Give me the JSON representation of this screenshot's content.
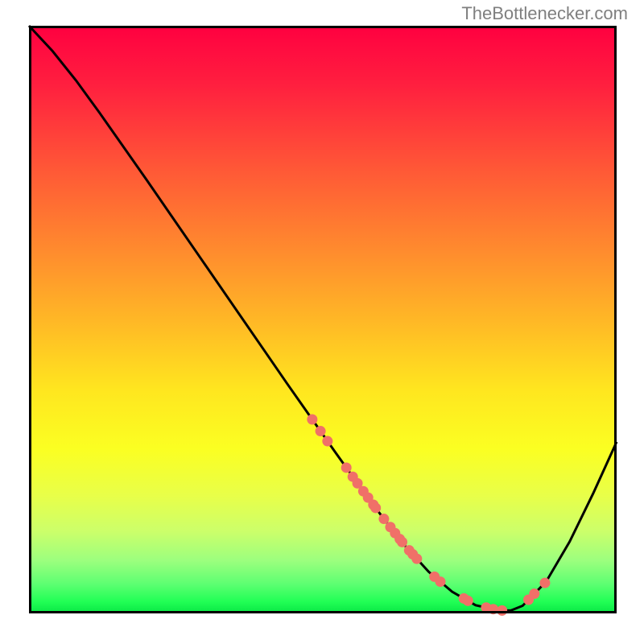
{
  "watermark": "TheBottlenecker.com",
  "chart_data": {
    "type": "line",
    "title": "",
    "xlabel": "",
    "ylabel": "",
    "xlim": [
      0,
      100
    ],
    "ylim": [
      0,
      100
    ],
    "curve": [
      {
        "x": 0.0,
        "y": 100.0
      },
      {
        "x": 4.0,
        "y": 95.7
      },
      {
        "x": 8.0,
        "y": 90.7
      },
      {
        "x": 12.0,
        "y": 85.2
      },
      {
        "x": 16.0,
        "y": 79.5
      },
      {
        "x": 20.0,
        "y": 73.8
      },
      {
        "x": 24.0,
        "y": 68.0
      },
      {
        "x": 28.0,
        "y": 62.2
      },
      {
        "x": 32.0,
        "y": 56.4
      },
      {
        "x": 36.0,
        "y": 50.6
      },
      {
        "x": 40.0,
        "y": 44.8
      },
      {
        "x": 44.0,
        "y": 39.0
      },
      {
        "x": 48.0,
        "y": 33.3
      },
      {
        "x": 52.0,
        "y": 27.6
      },
      {
        "x": 56.0,
        "y": 22.0
      },
      {
        "x": 60.0,
        "y": 16.6
      },
      {
        "x": 64.0,
        "y": 11.5
      },
      {
        "x": 68.0,
        "y": 7.1
      },
      {
        "x": 72.0,
        "y": 3.7
      },
      {
        "x": 76.0,
        "y": 1.4
      },
      {
        "x": 80.0,
        "y": 0.5
      },
      {
        "x": 82.0,
        "y": 0.5
      },
      {
        "x": 84.0,
        "y": 1.3
      },
      {
        "x": 88.0,
        "y": 5.4
      },
      {
        "x": 92.0,
        "y": 12.2
      },
      {
        "x": 96.0,
        "y": 20.4
      },
      {
        "x": 100.0,
        "y": 29.2
      }
    ],
    "points_on_curve_x": [
      48.2,
      49.6,
      50.8,
      54.0,
      55.1,
      55.9,
      56.9,
      57.7,
      58.6,
      59.0,
      60.4,
      61.5,
      62.3,
      63.1,
      63.5,
      64.7,
      65.3,
      66.0,
      69.0,
      70.0,
      74.0,
      74.7,
      77.8,
      79.0,
      80.5,
      85.0,
      86.0,
      87.8
    ],
    "point_color": "#f07068",
    "point_radius": 6.5,
    "line_color": "#000000",
    "line_width": 3.0
  }
}
